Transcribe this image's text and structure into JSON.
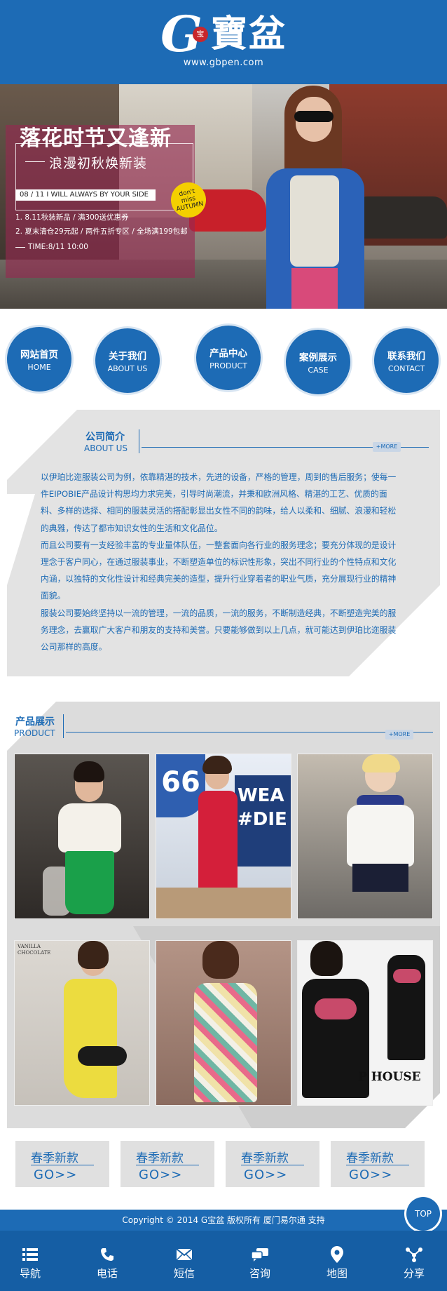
{
  "header": {
    "logo_letter": "G",
    "logo_seal": "宝",
    "logo_name": "寶盆",
    "logo_url": "www.gbpen.com",
    "bg_color": "#1d6bb5"
  },
  "banner": {
    "title": "落花时节又逢新",
    "subtitle": "浪漫初秋焕新装",
    "date_line": "08 / 11  I WILL ALWAYS BY YOUR SIDE",
    "badge_lines": [
      "don't",
      "miss",
      "AUTUMN"
    ],
    "promo_lines": [
      "1. 8.11秋装新品 / 满300送优惠券",
      "2. 夏末清仓29元起 / 两件五折专区 / 全场满199包邮",
      "TIME:8/11  10:00"
    ]
  },
  "nav": [
    {
      "cn": "网站首页",
      "en": "HOME"
    },
    {
      "cn": "关于我们",
      "en": "ABOUT US"
    },
    {
      "cn": "产品中心",
      "en": "PRODUCT"
    },
    {
      "cn": "案例展示",
      "en": "CASE"
    },
    {
      "cn": "联系我们",
      "en": "CONTACT"
    }
  ],
  "about": {
    "title_cn": "公司简介",
    "title_en": "ABOUT US",
    "more_label": "+MORE",
    "paragraphs": [
      "以伊珀比迩服装公司为例，依靠精湛的技术，先进的设备，严格的管理，周到的售后服务；使每一件EIPOBIE产品设计构思均力求完美，引导时尚潮流，并秉和欧洲风格、精湛的工艺、优质的面料、多样的选择、相同的服装灵活的搭配彰显出女性不同的韵味，给人以柔和、细腻、浪漫和轻松的典雅，传达了都市知识女性的生活和文化品位。",
      "而且公司要有一支经验丰富的专业量体队伍，一整套面向各行业的服务理念；要充分体现的是设计理念于客户同心，在通过服装事业，不断塑造单位的标识性形象，突出不同行业的个性特点和文化内涵，以独特的文化性设计和经典完美的造型，提升行业穿着者的职业气质，充分展现行业的精神面貌。",
      "服装公司要始终坚持以一流的管理，一流的品质，一流的服务，不断制造经典，不断塑造完美的服务理念，去赢取广大客户和朋友的支持和美誉。只要能够做到以上几点，就可能达到伊珀比迩服装公司那样的高度。"
    ]
  },
  "product": {
    "title_cn": "产品展示",
    "title_en": "PRODUCT",
    "more_label": "+MORE",
    "image_texts": {
      "route_sign": "66",
      "wall_text": "WEA #DIE",
      "vanilla": "VANILLA CHOCOLATE",
      "house": "P HOUSE"
    }
  },
  "spring_tiles": [
    {
      "title": "春季新款",
      "go": "GO>>"
    },
    {
      "title": "春季新款",
      "go": "GO>>"
    },
    {
      "title": "春季新款",
      "go": "GO>>"
    },
    {
      "title": "春季新款",
      "go": "GO>>"
    }
  ],
  "footer": {
    "copyright": "Copyright © 2014 G宝盆 版权所有  厦门易尔通 支持",
    "top_label": "TOP",
    "bar": [
      {
        "label": "导航",
        "icon": "list-icon"
      },
      {
        "label": "电话",
        "icon": "phone-icon"
      },
      {
        "label": "短信",
        "icon": "mail-icon"
      },
      {
        "label": "咨询",
        "icon": "chat-icon"
      },
      {
        "label": "地图",
        "icon": "map-pin-icon"
      },
      {
        "label": "分享",
        "icon": "share-icon"
      }
    ]
  }
}
